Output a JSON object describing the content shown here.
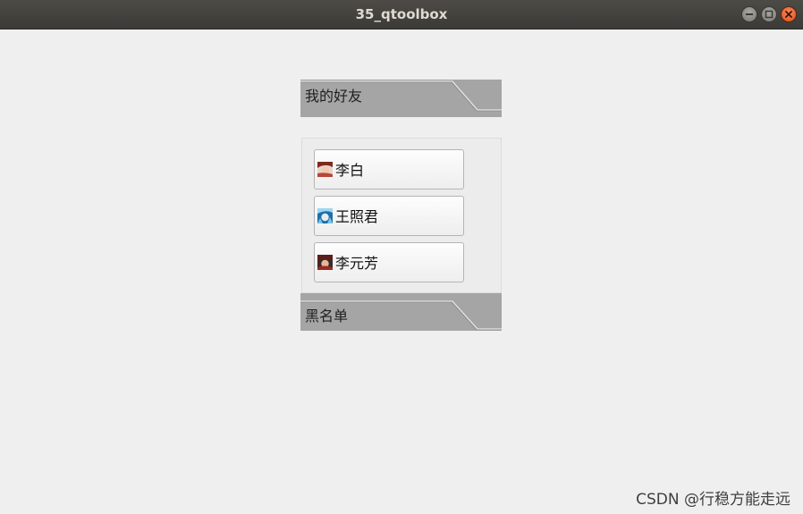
{
  "window": {
    "title": "35_qtoolbox",
    "controls": [
      "minimize-icon",
      "maximize-icon",
      "close-icon"
    ]
  },
  "toolbox": {
    "pages": [
      {
        "label": "我的好友",
        "expanded": true,
        "items": [
          {
            "name": "李白",
            "icon": "avatar-li-bai"
          },
          {
            "name": "王照君",
            "icon": "avatar-wang-zhaojun"
          },
          {
            "name": "李元芳",
            "icon": "avatar-li-yuanfang"
          }
        ]
      },
      {
        "label": "黑名单",
        "expanded": false,
        "items": []
      }
    ]
  },
  "watermark": "CSDN @行稳方能走远",
  "colors": {
    "titlebar": "#3f3e3a",
    "background": "#efefef",
    "tab_header": "#a6a6a6",
    "close_button": "#e95420"
  }
}
